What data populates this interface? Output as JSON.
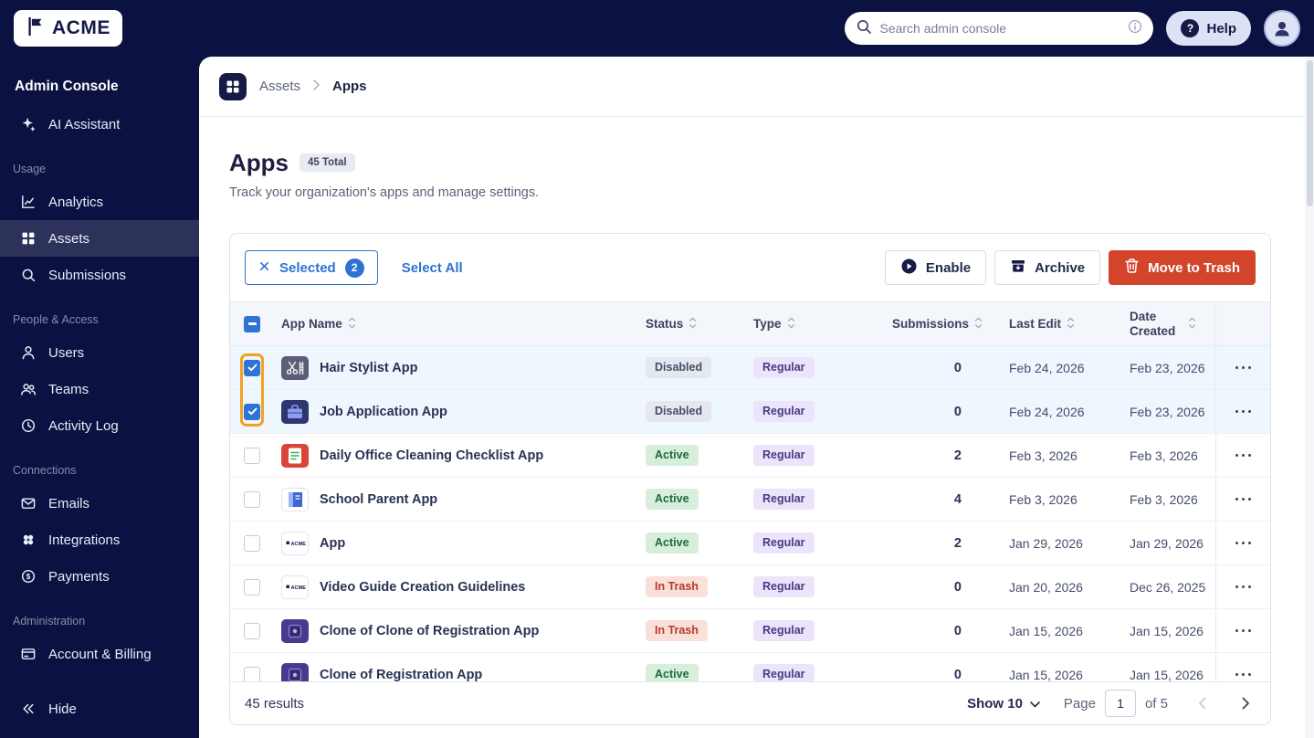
{
  "topbar": {
    "logo_text": "ACME",
    "search_placeholder": "Search admin console",
    "help_label": "Help"
  },
  "sidebar": {
    "title": "Admin Console",
    "ai_label": "AI Assistant",
    "sections": [
      {
        "label": "Usage",
        "items": [
          {
            "label": "Analytics"
          },
          {
            "label": "Assets"
          },
          {
            "label": "Submissions"
          }
        ]
      },
      {
        "label": "People & Access",
        "items": [
          {
            "label": "Users"
          },
          {
            "label": "Teams"
          },
          {
            "label": "Activity Log"
          }
        ]
      },
      {
        "label": "Connections",
        "items": [
          {
            "label": "Emails"
          },
          {
            "label": "Integrations"
          },
          {
            "label": "Payments"
          }
        ]
      },
      {
        "label": "Administration",
        "items": [
          {
            "label": "Account & Billing"
          }
        ]
      }
    ],
    "hide_label": "Hide"
  },
  "breadcrumb": {
    "root": "Assets",
    "current": "Apps"
  },
  "page": {
    "title": "Apps",
    "total_badge": "45 Total",
    "subtitle": "Track your organization's apps and manage settings."
  },
  "toolbar": {
    "selected_label": "Selected",
    "selected_count": "2",
    "select_all_label": "Select All",
    "enable_label": "Enable",
    "archive_label": "Archive",
    "move_to_trash_label": "Move to Trash"
  },
  "table": {
    "columns": {
      "app_name": "App Name",
      "status": "Status",
      "type": "Type",
      "submissions": "Submissions",
      "last_edit": "Last Edit",
      "date_created": "Date Created"
    },
    "rows": [
      {
        "name": "Hair Stylist App",
        "status": "Disabled",
        "type": "Regular",
        "submissions": "0",
        "last_edit": "Feb 24, 2026",
        "date_created": "Feb 23, 2026",
        "checked": true,
        "icon": "scissors"
      },
      {
        "name": "Job Application App",
        "status": "Disabled",
        "type": "Regular",
        "submissions": "0",
        "last_edit": "Feb 24, 2026",
        "date_created": "Feb 23, 2026",
        "checked": true,
        "icon": "briefcase"
      },
      {
        "name": "Daily Office Cleaning Checklist App",
        "status": "Active",
        "type": "Regular",
        "submissions": "2",
        "last_edit": "Feb 3, 2026",
        "date_created": "Feb 3, 2026",
        "checked": false,
        "icon": "checklist"
      },
      {
        "name": "School Parent App",
        "status": "Active",
        "type": "Regular",
        "submissions": "4",
        "last_edit": "Feb 3, 2026",
        "date_created": "Feb 3, 2026",
        "checked": false,
        "icon": "book"
      },
      {
        "name": "App",
        "status": "Active",
        "type": "Regular",
        "submissions": "2",
        "last_edit": "Jan 29, 2026",
        "date_created": "Jan 29, 2026",
        "checked": false,
        "icon": "acme"
      },
      {
        "name": "Video Guide Creation Guidelines",
        "status": "In Trash",
        "type": "Regular",
        "submissions": "0",
        "last_edit": "Jan 20, 2026",
        "date_created": "Dec 26, 2025",
        "checked": false,
        "icon": "acme"
      },
      {
        "name": "Clone of Clone of Registration App",
        "status": "In Trash",
        "type": "Regular",
        "submissions": "0",
        "last_edit": "Jan 15, 2026",
        "date_created": "Jan 15, 2026",
        "checked": false,
        "icon": "purple"
      },
      {
        "name": "Clone of Registration App",
        "status": "Active",
        "type": "Regular",
        "submissions": "0",
        "last_edit": "Jan 15, 2026",
        "date_created": "Jan 15, 2026",
        "checked": false,
        "icon": "purple"
      }
    ]
  },
  "footer": {
    "results": "45 results",
    "show_label": "Show 10",
    "page_label": "Page",
    "page_value": "1",
    "of_label": "of 5"
  },
  "annotation": {
    "color": "#f5a01f"
  }
}
